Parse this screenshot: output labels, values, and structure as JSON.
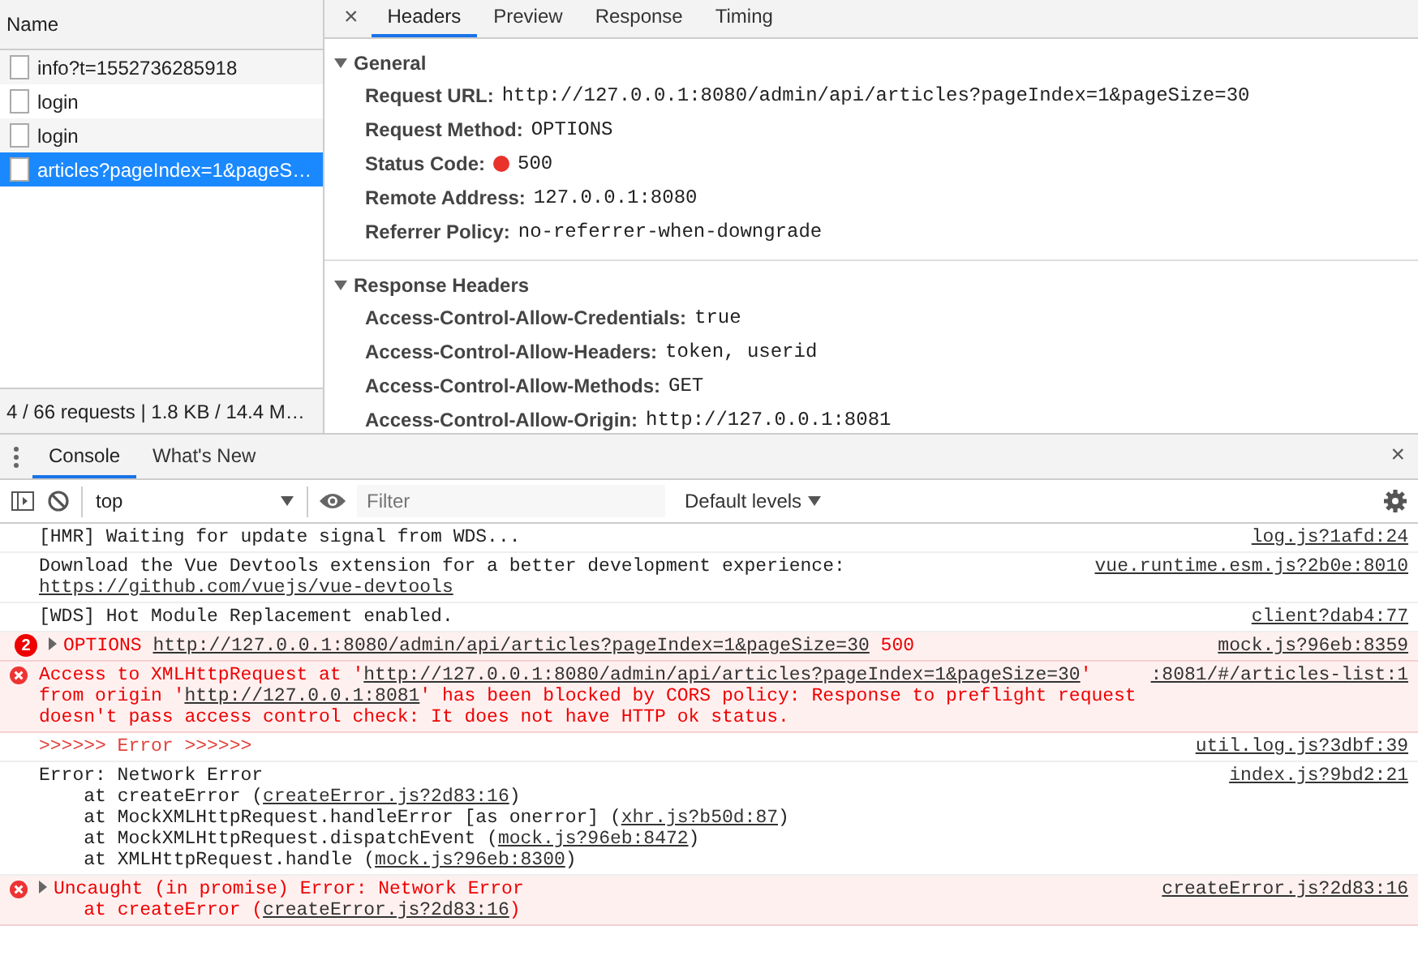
{
  "network": {
    "column_header": "Name",
    "requests": [
      {
        "name": "info?t=1552736285918",
        "selected": false
      },
      {
        "name": "login",
        "selected": false
      },
      {
        "name": "login",
        "selected": false
      },
      {
        "name": "articles?pageIndex=1&pageS…",
        "selected": true
      }
    ],
    "summary": "4 / 66 requests | 1.8 KB / 14.4 M…"
  },
  "details": {
    "close": "×",
    "tabs": [
      {
        "label": "Headers",
        "selected": true
      },
      {
        "label": "Preview",
        "selected": false
      },
      {
        "label": "Response",
        "selected": false
      },
      {
        "label": "Timing",
        "selected": false
      }
    ],
    "sections": [
      {
        "title": "General",
        "expanded": true,
        "rows": [
          {
            "key": "Request URL:",
            "value": "http://127.0.0.1:8080/admin/api/articles?pageIndex=1&pageSize=30"
          },
          {
            "key": "Request Method:",
            "value": "OPTIONS"
          },
          {
            "key": "Status Code:",
            "value": "500",
            "color": "#e8322b"
          },
          {
            "key": "Remote Address:",
            "value": "127.0.0.1:8080"
          },
          {
            "key": "Referrer Policy:",
            "value": "no-referrer-when-downgrade"
          }
        ]
      },
      {
        "title": "Response Headers",
        "expanded": true,
        "rows": [
          {
            "key": "Access-Control-Allow-Credentials:",
            "value": "true"
          },
          {
            "key": "Access-Control-Allow-Headers:",
            "value": "token, userid"
          },
          {
            "key": "Access-Control-Allow-Methods:",
            "value": "GET"
          },
          {
            "key": "Access-Control-Allow-Origin:",
            "value": "http://127.0.0.1:8081"
          }
        ]
      }
    ]
  },
  "drawer": {
    "tabs": [
      {
        "label": "Console",
        "selected": true
      },
      {
        "label": "What's New",
        "selected": false
      }
    ],
    "close": "×"
  },
  "toolbar": {
    "context": "top",
    "filter_placeholder": "Filter",
    "levels": "Default levels"
  },
  "messages": [
    {
      "kind": "log",
      "source": "log.js?1afd:24",
      "lines": [
        [
          {
            "text": "[HMR] Waiting for update signal from WDS..."
          }
        ]
      ]
    },
    {
      "kind": "log",
      "source": "vue.runtime.esm.js?2b0e:8010",
      "lines": [
        [
          {
            "text": "Download the Vue Devtools extension for a better development experience:"
          }
        ],
        [
          {
            "text": "https://github.com/vuejs/vue-devtools",
            "link": true
          }
        ]
      ]
    },
    {
      "kind": "log",
      "source": "client?dab4:77",
      "lines": [
        [
          {
            "text": "[WDS] Hot Module Replacement enabled."
          }
        ]
      ]
    },
    {
      "kind": "error",
      "count": "2",
      "expanded": false,
      "source": "mock.js?96eb:8359",
      "lines": [
        [
          {
            "text": "OPTIONS "
          },
          {
            "text": "http://127.0.0.1:8080/admin/api/articles?pageIndex=1&pageSize=30",
            "link": true
          },
          {
            "text": " 500"
          }
        ]
      ]
    },
    {
      "kind": "error",
      "source": ":8081/#/articles-list:1",
      "lines": [
        [
          {
            "text": "Access to XMLHttpRequest at '"
          },
          {
            "text": "http://127.0.0.1:8080/admin/api/articles?pageIndex=1&pageSize=30",
            "link": true
          },
          {
            "text": "' from origin '"
          },
          {
            "text": "http://127.0.0.1:8081",
            "link": true
          },
          {
            "text": "' has been blocked by CORS policy: Response to preflight request doesn't pass access control check: It does not have HTTP ok status."
          }
        ]
      ]
    },
    {
      "kind": "styled",
      "source": "util.log.js?3dbf:39",
      "lines": [
        [
          {
            "text": ">>>>>> Error >>>>>>"
          }
        ]
      ]
    },
    {
      "kind": "log",
      "source": "index.js?9bd2:21",
      "lines": [
        [
          {
            "text": "Error: Network Error"
          }
        ],
        [
          {
            "text": "    at createError ("
          },
          {
            "text": "createError.js?2d83:16",
            "link": true
          },
          {
            "text": ")"
          }
        ],
        [
          {
            "text": "    at MockXMLHttpRequest.handleError [as onerror] ("
          },
          {
            "text": "xhr.js?b50d:87",
            "link": true
          },
          {
            "text": ")"
          }
        ],
        [
          {
            "text": "    at MockXMLHttpRequest.dispatchEvent ("
          },
          {
            "text": "mock.js?96eb:8472",
            "link": true
          },
          {
            "text": ")"
          }
        ],
        [
          {
            "text": "    at XMLHttpRequest.handle ("
          },
          {
            "text": "mock.js?96eb:8300",
            "link": true
          },
          {
            "text": ")"
          }
        ]
      ]
    },
    {
      "kind": "error",
      "expanded": false,
      "source": "createError.js?2d83:16",
      "lines": [
        [
          {
            "text": "Uncaught (in promise) Error: Network Error"
          }
        ],
        [
          {
            "text": "    at createError ("
          },
          {
            "text": "createError.js?2d83:16",
            "link": true
          },
          {
            "text": ")"
          }
        ]
      ]
    }
  ]
}
